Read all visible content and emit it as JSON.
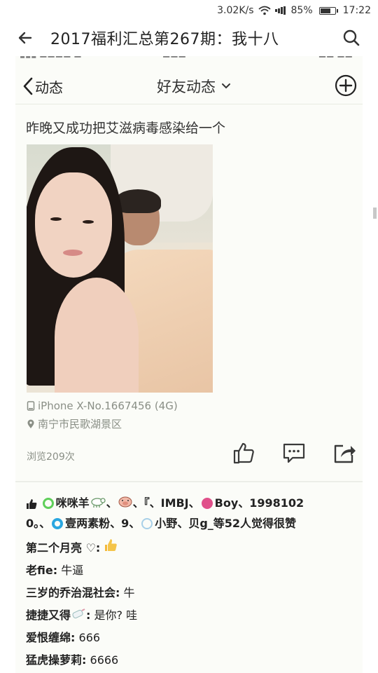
{
  "status_bar": {
    "network_speed": "3.02K/s",
    "battery": "85%",
    "battery_level": 0.85,
    "time": "17:22"
  },
  "app_bar": {
    "title": "2017福利汇总第267期：我十八"
  },
  "inner_nav": {
    "back_label": "动态",
    "title": "好友动态"
  },
  "post": {
    "text": "昨晚又成功把艾滋病毒感染给一个",
    "device": "iPhone X-No.1667456 (4G)",
    "location": "南宁市民歌湖景区",
    "views": "浏览209次"
  },
  "likes": {
    "names": [
      "咪咪羊",
      "、",
      "、『、IMBJ、",
      "Boy、1998102",
      "0。、",
      "壹两素粉",
      "、9、",
      "小野",
      "、贝g_",
      "等52人觉得很赞"
    ]
  },
  "comments": [
    {
      "name": "第二个月亮 ♡",
      "sep": ":",
      "text": ""
    },
    {
      "name": "老fie",
      "sep": ":",
      "text": " 牛逼"
    },
    {
      "name": "三岁的乔治混社会",
      "sep": ":",
      "text": " 牛"
    },
    {
      "name": "捷捷又得",
      "sep": ":",
      "text": " 是你? 哇"
    },
    {
      "name": "爱恨缠绵",
      "sep": ":",
      "text": " 666"
    },
    {
      "name": "猛虎操萝莉",
      "sep": ":",
      "text": " 6666"
    }
  ],
  "colors": {
    "meta_gray": "#8a8f86",
    "icon_dark": "#3a3a3a",
    "green_circle": "#5fcf5a",
    "pink_circle": "#e0508a",
    "blue_circle": "#2aa7e0"
  }
}
